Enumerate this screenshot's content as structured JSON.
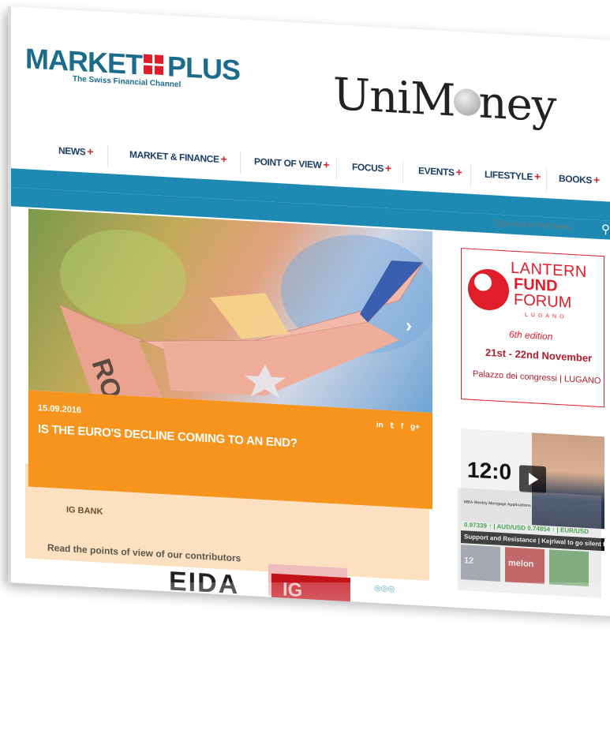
{
  "brand": {
    "marketplus": {
      "left": "MARKET",
      "right": "PLUS",
      "tagline": "The Swiss Financial Channel"
    },
    "unimoney": {
      "before": "UniM",
      "after": "ney"
    }
  },
  "nav": {
    "items": [
      {
        "label": "NEWS"
      },
      {
        "label": "MARKET & FINANCE"
      },
      {
        "label": "POINT OF VIEW"
      },
      {
        "label": "FOCUS"
      },
      {
        "label": "EVENTS"
      },
      {
        "label": "LIFESTYLE"
      },
      {
        "label": "BOOKS"
      }
    ],
    "plus": "+"
  },
  "search": {
    "placeholder": "Type text to find news",
    "icon": "search-icon"
  },
  "hero": {
    "note_text": "RO",
    "next_arrow": "›",
    "date": "15.09.2016",
    "title": "IS THE EURO'S DECLINE COMING TO AN END?",
    "social": [
      "in",
      "𝕥",
      "f",
      "g+"
    ]
  },
  "source": "IG BANK",
  "contributors": {
    "heading": "Read the points of view of our contributors",
    "partners": [
      "EIDA",
      "IG"
    ]
  },
  "ad": {
    "line1": "LANTERN",
    "line2": "FUND",
    "line3": "FORUM",
    "line4": "LUGANO",
    "edition": "6th edition",
    "dates": "21st - 22nd November",
    "venue": "Palazzo dei congressi | LUGANO"
  },
  "video": {
    "big": "12:0",
    "caption": "MBA Weekly Mortgage Applications",
    "ticker": "0.97339 ↑ | AUD/USD 0.74854 ↑ | EUR/USD",
    "strip": "Support and Resistance | Kejriwal to go silent fo",
    "thumbs": [
      "12",
      "melon",
      ""
    ]
  },
  "colors": {
    "brand_blue": "#1b6c8c",
    "nav_bar": "#1e8ab4",
    "accent_red": "#e01e2b",
    "caption_orange": "#f7941d"
  }
}
